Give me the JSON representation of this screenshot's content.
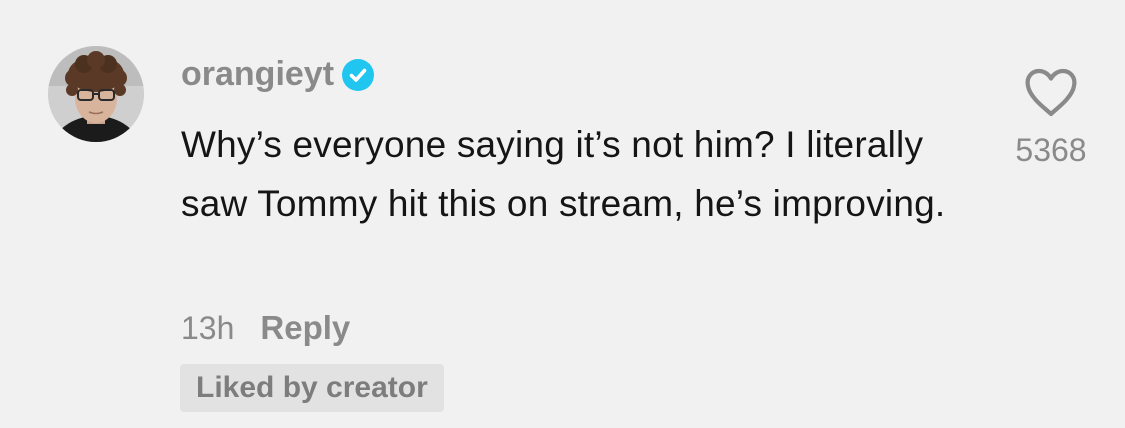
{
  "comment": {
    "username": "orangieyt",
    "verified": true,
    "text": "Why’s everyone saying it’s not him? I literally saw Tommy hit this on stream, he’s improving.",
    "timestamp": "13h",
    "reply_label": "Reply",
    "badge_label": "Liked by creator",
    "like_count": "5368"
  },
  "icons": {
    "avatar": "profile-photo",
    "verified": "verified-check-icon",
    "like": "heart-outline-icon"
  },
  "colors": {
    "background": "#f1f1f1",
    "verified_badge": "#20c5f0",
    "secondary_text": "#8a8a8a",
    "primary_text": "#151515",
    "badge_background": "#e2e2e2"
  }
}
